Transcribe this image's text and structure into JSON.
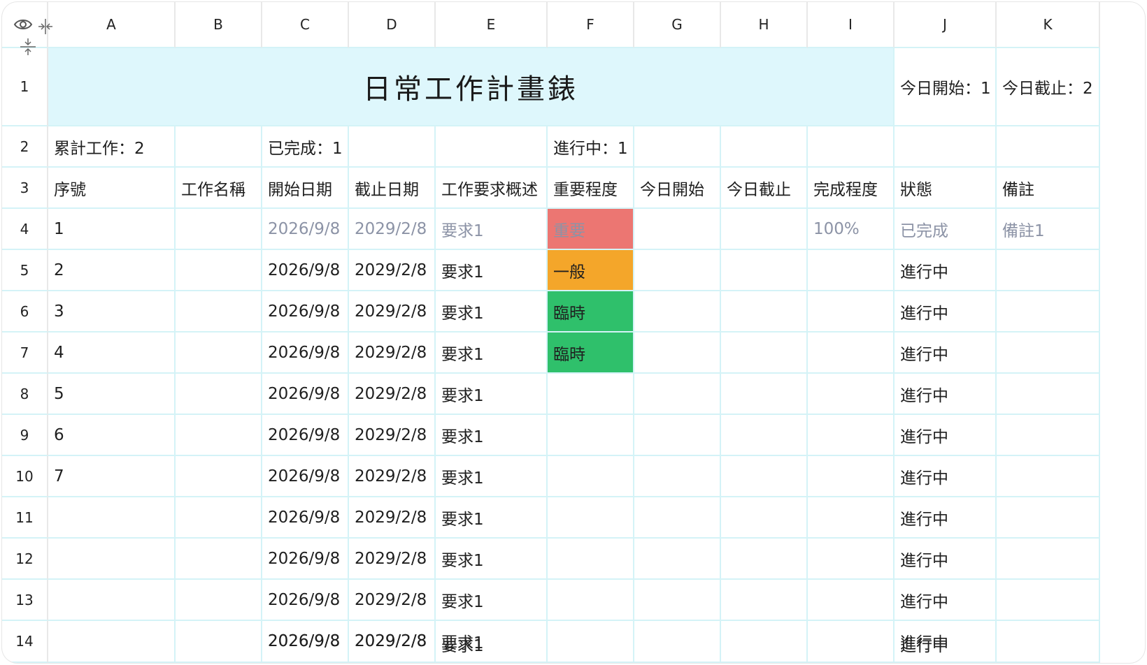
{
  "columns": [
    "A",
    "B",
    "C",
    "D",
    "E",
    "F",
    "G",
    "H",
    "I",
    "J",
    "K"
  ],
  "rows": [
    "1",
    "2",
    "3",
    "4",
    "5",
    "6",
    "7",
    "8",
    "9",
    "10",
    "11",
    "12",
    "13",
    "14"
  ],
  "title": "日常工作計畫錶",
  "today_start_label": "今日開始：1",
  "today_due_label": "今日截止：2",
  "summary": {
    "total": "累計工作：2",
    "done": "已完成：1",
    "in_progress": "進行中：1"
  },
  "headers": [
    "序號",
    "工作名稱",
    "開始日期",
    "截止日期",
    "工作要求概述",
    "重要程度",
    "今日開始",
    "今日截止",
    "完成程度",
    "狀態",
    "備註"
  ],
  "records": [
    {
      "no": "1",
      "start": "2026/9/8",
      "end": "2029/2/8",
      "req": "要求1",
      "importance": "重要",
      "pct": "100%",
      "status": "已完成",
      "note": "備註1"
    },
    {
      "no": "2",
      "start": "2026/9/8",
      "end": "2029/2/8",
      "req": "要求1",
      "importance": "一般",
      "pct": "",
      "status": "進行中",
      "note": ""
    },
    {
      "no": "3",
      "start": "2026/9/8",
      "end": "2029/2/8",
      "req": "要求1",
      "importance": "臨時",
      "pct": "",
      "status": "進行中",
      "note": ""
    },
    {
      "no": "4",
      "start": "2026/9/8",
      "end": "2029/2/8",
      "req": "要求1",
      "importance": "臨時",
      "pct": "",
      "status": "進行中",
      "note": ""
    },
    {
      "no": "5",
      "start": "2026/9/8",
      "end": "2029/2/8",
      "req": "要求1",
      "importance": "",
      "pct": "",
      "status": "進行中",
      "note": ""
    },
    {
      "no": "6",
      "start": "2026/9/8",
      "end": "2029/2/8",
      "req": "要求1",
      "importance": "",
      "pct": "",
      "status": "進行中",
      "note": ""
    },
    {
      "no": "7",
      "start": "2026/9/8",
      "end": "2029/2/8",
      "req": "要求1",
      "importance": "",
      "pct": "",
      "status": "進行中",
      "note": ""
    },
    {
      "no": "",
      "start": "2026/9/8",
      "end": "2029/2/8",
      "req": "要求1",
      "importance": "",
      "pct": "",
      "status": "進行中",
      "note": ""
    },
    {
      "no": "",
      "start": "2026/9/8",
      "end": "2029/2/8",
      "req": "要求1",
      "importance": "",
      "pct": "",
      "status": "進行中",
      "note": ""
    },
    {
      "no": "",
      "start": "2026/9/8",
      "end": "2029/2/8",
      "req": "要求1",
      "importance": "",
      "pct": "",
      "status": "進行中",
      "note": ""
    },
    {
      "no": "",
      "start": "2026/9/8",
      "end": "2029/2/8",
      "req": "要求1",
      "importance": "",
      "pct": "",
      "status": "進行中",
      "note": ""
    }
  ],
  "colors": {
    "important": "#ec7672",
    "normal": "#f4a62a",
    "temporary": "#2fc06b",
    "title_bg": "#def7fc"
  },
  "icons": [
    "eye-icon",
    "collapse-columns-icon",
    "collapse-rows-icon"
  ]
}
